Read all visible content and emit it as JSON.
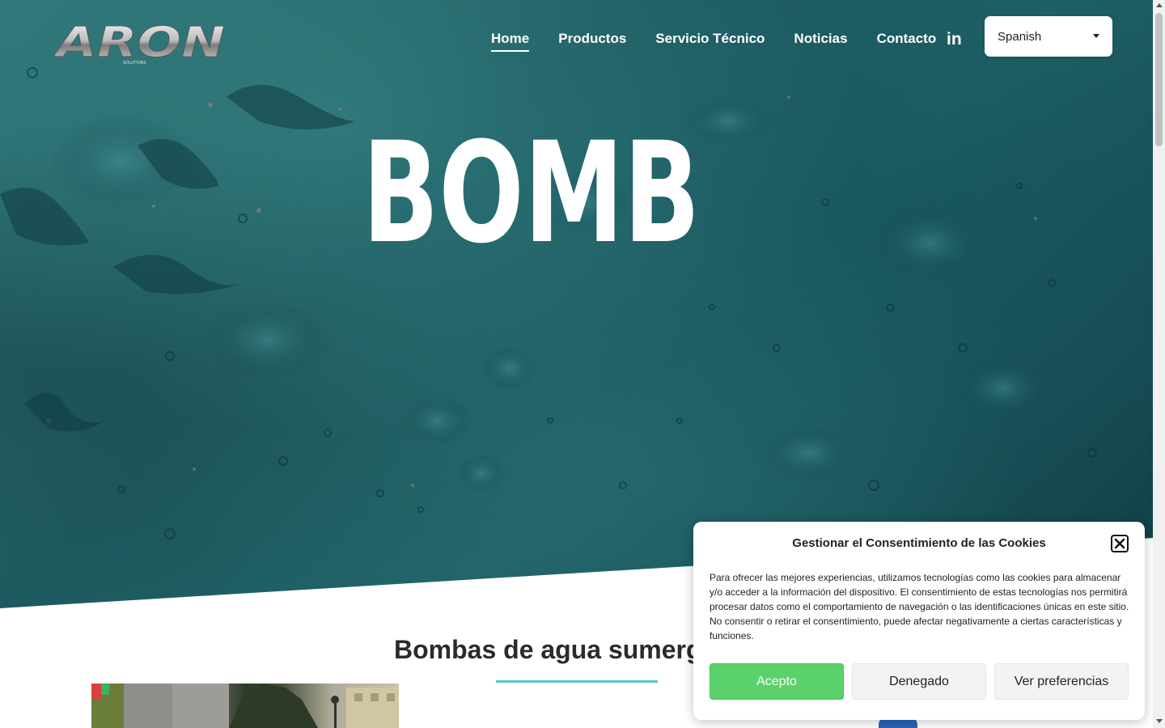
{
  "header": {
    "logo_text": "ARON",
    "logo_subtext": "SOLUTIONS",
    "nav": [
      {
        "label": "Home",
        "active": true
      },
      {
        "label": "Productos",
        "active": false
      },
      {
        "label": "Servicio Técnico",
        "active": false
      },
      {
        "label": "Noticias",
        "active": false
      },
      {
        "label": "Contacto",
        "active": false
      }
    ],
    "social_icon": "linkedin-icon",
    "social_label": "in",
    "language": {
      "selected": "Spanish"
    }
  },
  "hero": {
    "title": "BOMBA",
    "background": "water-surface"
  },
  "section": {
    "title": "Bombas de agua sumerg",
    "underline_color": "#5bc2d4"
  },
  "cookie_banner": {
    "title": "Gestionar el Consentimiento de las Cookies",
    "body": "Para ofrecer las mejores experiencias, utilizamos tecnologías como las cookies para almacenar y/o acceder a la información del dispositivo. El consentimiento de estas tecnologías nos permitirá procesar datos como el comportamiento de navegación o las identificaciones únicas en este sitio. No consentir o retirar el consentimiento, puede afectar negativamente a ciertas características y funciones.",
    "accept_label": "Acepto",
    "deny_label": "Denegado",
    "prefs_label": "Ver preferencias",
    "accept_color": "#5ad16a"
  }
}
